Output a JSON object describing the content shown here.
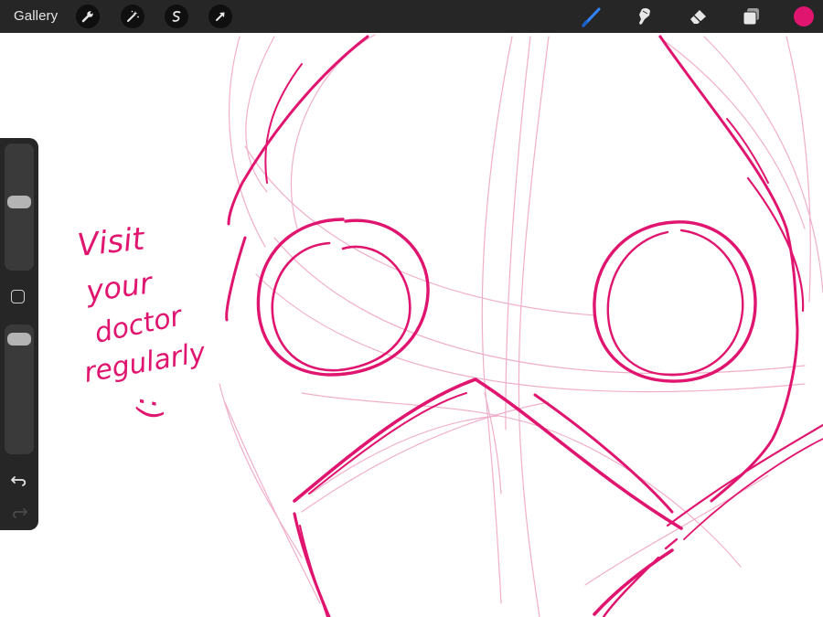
{
  "topbar": {
    "gallery_label": "Gallery",
    "left_tools": [
      "wrench-icon",
      "magic-wand-icon",
      "selection-icon",
      "transform-arrow-icon"
    ],
    "right_tools": [
      "brush-icon",
      "smudge-icon",
      "eraser-icon",
      "layers-icon"
    ],
    "active_tool": "brush",
    "active_color": "#e0156f"
  },
  "sidebar": {
    "brush_size_level": 0.55,
    "opacity_level": 0.95,
    "buttons": [
      "modify-button",
      "undo-icon",
      "redo-icon"
    ]
  },
  "canvas": {
    "ink_color": "#e0156f",
    "guide_color": "#efa7c4",
    "handwritten_note": {
      "lines": [
        "Visit",
        "your",
        "doctor",
        "regularly",
        ":)"
      ]
    }
  },
  "colors": {
    "toolbar_bg": "#262626",
    "button_bg": "#0f0f0f",
    "icon_light": "#e6e6e6",
    "brush_blue": "#2f86ff"
  }
}
